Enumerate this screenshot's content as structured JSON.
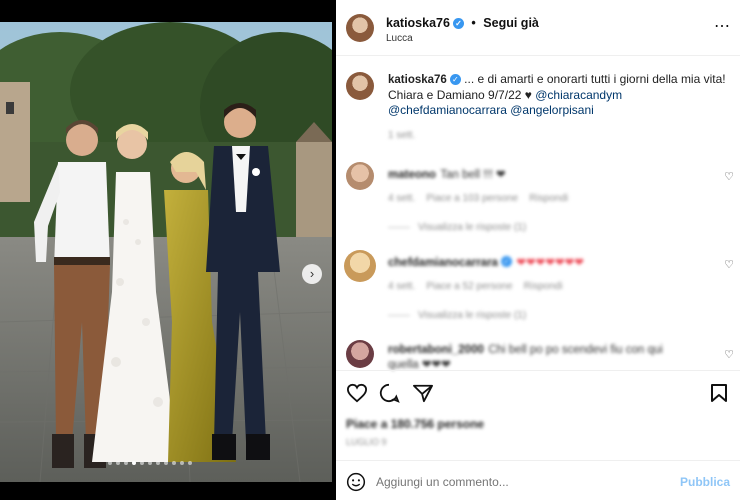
{
  "post": {
    "username": "katioska76",
    "dot": "•",
    "follow_label": "Segui già",
    "location": "Lucca",
    "more": "⋯"
  },
  "caption": {
    "username": "katioska76",
    "text": "... e di amarti e onorarti tutti i giorni della mia vita! Chiara e Damiano 9/7/22 ♥",
    "mentions": [
      "@chiaracandym",
      "@chefdamianocarrara",
      "@angelorpisani"
    ],
    "time": "1 sett."
  },
  "comments": [
    {
      "username": "mateono",
      "text": "Tan bell !!! ❤",
      "time": "4 sett.",
      "likes": "Piace a 103 persone",
      "reply": "Rispondi",
      "replies": "Visualizza le risposte (1)"
    },
    {
      "username": "chefdamianocarrara",
      "text": "❤❤❤❤❤❤❤",
      "time": "4 sett.",
      "likes": "Piace a 52 persone",
      "reply": "Rispondi",
      "replies": "Visualizza le risposte (1)"
    },
    {
      "username": "robertaboni_2000",
      "text": "Chi bell po po scendevi fiu con qui quella ❤❤❤"
    }
  ],
  "stats": {
    "likes": "Piace a 180.756 persone",
    "date": "LUGLIO 9"
  },
  "add_comment": {
    "placeholder": "Aggiungi un commento...",
    "publish": "Pubblica"
  },
  "carousel": {
    "count": 11,
    "active": 3
  },
  "colors": {
    "accent": "#0095f6",
    "verified": "#3897f0",
    "heart": "#ed4956"
  }
}
